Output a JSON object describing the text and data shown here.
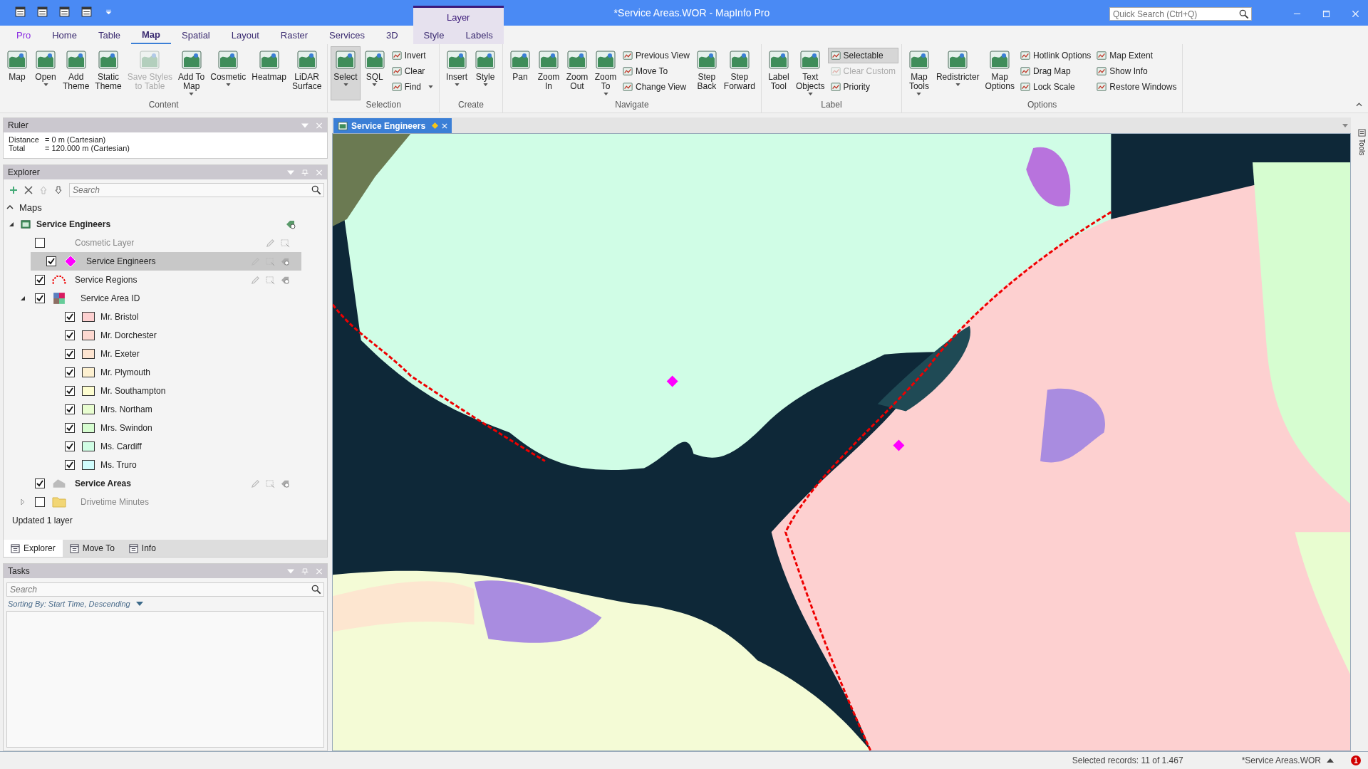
{
  "window": {
    "title": "*Service Areas.WOR - MapInfo Pro",
    "quick_search": {
      "placeholder": "Quick Search (Ctrl+Q)"
    }
  },
  "ribbon_tabs": [
    {
      "label": "Pro",
      "kind": "file",
      "selected": false
    },
    {
      "label": "Home",
      "kind": "normal",
      "selected": false
    },
    {
      "label": "Table",
      "kind": "normal",
      "selected": false
    },
    {
      "label": "Map",
      "kind": "normal",
      "selected": true
    },
    {
      "label": "Spatial",
      "kind": "normal",
      "selected": false
    },
    {
      "label": "Layout",
      "kind": "normal",
      "selected": false
    },
    {
      "label": "Raster",
      "kind": "normal",
      "selected": false
    },
    {
      "label": "Services",
      "kind": "normal",
      "selected": false
    },
    {
      "label": "3D",
      "kind": "normal",
      "selected": false
    },
    {
      "label": "Style",
      "kind": "contextual",
      "selected": false
    },
    {
      "label": "Labels",
      "kind": "contextual",
      "selected": false
    }
  ],
  "contextual_group": "Layer",
  "ribbon_groups": [
    {
      "label": "Content",
      "items": [
        {
          "kind": "large",
          "label": "Map",
          "dropdown": false,
          "disabled": false,
          "selected": false
        },
        {
          "kind": "large",
          "label": "Open",
          "dropdown": true,
          "disabled": false,
          "selected": false
        },
        {
          "kind": "large",
          "label": "Add\nTheme",
          "dropdown": false,
          "disabled": false,
          "selected": false
        },
        {
          "kind": "large",
          "label": "Static\nTheme",
          "dropdown": false,
          "disabled": false,
          "selected": false
        },
        {
          "kind": "large",
          "label": "Save Styles\nto Table",
          "dropdown": false,
          "disabled": true,
          "selected": false
        },
        {
          "kind": "large",
          "label": "Add To\nMap",
          "dropdown": true,
          "disabled": false,
          "selected": false
        },
        {
          "kind": "large",
          "label": "Cosmetic",
          "dropdown": true,
          "disabled": false,
          "selected": false
        },
        {
          "kind": "large",
          "label": "Heatmap",
          "dropdown": false,
          "disabled": false,
          "selected": false
        },
        {
          "kind": "large",
          "label": "LiDAR\nSurface",
          "dropdown": false,
          "disabled": false,
          "selected": false
        }
      ]
    },
    {
      "label": "Selection",
      "items": [
        {
          "kind": "large",
          "label": "Select",
          "dropdown": true,
          "disabled": false,
          "selected": true
        },
        {
          "kind": "large",
          "label": "SQL",
          "dropdown": true,
          "disabled": false,
          "selected": false
        },
        {
          "kind": "stack",
          "items": [
            {
              "label": "Invert",
              "dropdown": false,
              "disabled": false,
              "selected": false
            },
            {
              "label": "Clear",
              "dropdown": false,
              "disabled": false,
              "selected": false
            },
            {
              "label": "Find",
              "dropdown": true,
              "disabled": false,
              "selected": false
            }
          ]
        }
      ]
    },
    {
      "label": "Create",
      "items": [
        {
          "kind": "large",
          "label": "Insert",
          "dropdown": true,
          "disabled": false,
          "selected": false
        },
        {
          "kind": "large",
          "label": "Style",
          "dropdown": true,
          "disabled": false,
          "selected": false
        }
      ]
    },
    {
      "label": "Navigate",
      "items": [
        {
          "kind": "large",
          "label": "Pan",
          "dropdown": false,
          "disabled": false,
          "selected": false
        },
        {
          "kind": "large",
          "label": "Zoom\nIn",
          "dropdown": false,
          "disabled": false,
          "selected": false
        },
        {
          "kind": "large",
          "label": "Zoom\nOut",
          "dropdown": false,
          "disabled": false,
          "selected": false
        },
        {
          "kind": "large",
          "label": "Zoom\nTo",
          "dropdown": true,
          "disabled": false,
          "selected": false
        },
        {
          "kind": "stack",
          "items": [
            {
              "label": "Previous View",
              "dropdown": false,
              "disabled": false,
              "selected": false
            },
            {
              "label": "Move To",
              "dropdown": false,
              "disabled": false,
              "selected": false
            },
            {
              "label": "Change View",
              "dropdown": false,
              "disabled": false,
              "selected": false
            }
          ]
        },
        {
          "kind": "large",
          "label": "Step\nBack",
          "dropdown": false,
          "disabled": false,
          "selected": false
        },
        {
          "kind": "large",
          "label": "Step\nForward",
          "dropdown": false,
          "disabled": false,
          "selected": false
        }
      ]
    },
    {
      "label": "Label",
      "items": [
        {
          "kind": "large",
          "label": "Label\nTool",
          "dropdown": false,
          "disabled": false,
          "selected": false
        },
        {
          "kind": "large",
          "label": "Text\nObjects",
          "dropdown": true,
          "disabled": false,
          "selected": false
        },
        {
          "kind": "stack",
          "items": [
            {
              "label": "Selectable",
              "dropdown": false,
              "disabled": false,
              "selected": true
            },
            {
              "label": "Clear Custom",
              "dropdown": false,
              "disabled": true,
              "selected": false
            },
            {
              "label": "Priority",
              "dropdown": false,
              "disabled": false,
              "selected": false
            }
          ]
        }
      ]
    },
    {
      "label": "Options",
      "items": [
        {
          "kind": "large",
          "label": "Map\nTools",
          "dropdown": true,
          "disabled": false,
          "selected": false
        },
        {
          "kind": "large",
          "label": "Redistricter",
          "dropdown": true,
          "disabled": false,
          "selected": false
        },
        {
          "kind": "large",
          "label": "Map\nOptions",
          "dropdown": false,
          "disabled": false,
          "selected": false
        },
        {
          "kind": "stack",
          "items": [
            {
              "label": "Hotlink Options",
              "dropdown": false,
              "disabled": false,
              "selected": false
            },
            {
              "label": "Drag Map",
              "dropdown": false,
              "disabled": false,
              "selected": false
            },
            {
              "label": "Lock Scale",
              "dropdown": false,
              "disabled": false,
              "selected": false
            }
          ]
        },
        {
          "kind": "stack",
          "items": [
            {
              "label": "Map Extent",
              "dropdown": false,
              "disabled": false,
              "selected": false
            },
            {
              "label": "Show Info",
              "dropdown": false,
              "disabled": false,
              "selected": false
            },
            {
              "label": "Restore Windows",
              "dropdown": false,
              "disabled": false,
              "selected": false
            }
          ]
        }
      ]
    }
  ],
  "ruler": {
    "title": "Ruler",
    "rows": [
      {
        "label": "Distance",
        "value": "= 0 m (Cartesian)"
      },
      {
        "label": "Total",
        "value": "= 120.000 m (Cartesian)"
      }
    ]
  },
  "explorer": {
    "title": "Explorer",
    "search": {
      "placeholder": "Search"
    },
    "tree": [
      {
        "label": "Maps",
        "kind": "section",
        "expanded": true,
        "children": [
          {
            "label": "Service Engineers",
            "kind": "map",
            "expanded": true,
            "children": [
              {
                "label": "Cosmetic Layer",
                "kind": "cosmetic",
                "checked": false,
                "dimmed": true,
                "selected": false
              },
              {
                "label": "Service Engineers",
                "kind": "point",
                "checked": true,
                "dimmed": false,
                "selected": true
              },
              {
                "label": "Service Regions",
                "kind": "boundary",
                "checked": true,
                "dimmed": false,
                "selected": false
              },
              {
                "label": "Service Area ID",
                "kind": "theme",
                "checked": true,
                "dimmed": false,
                "selected": false,
                "expanded": true,
                "children": [
                  {
                    "label": "Mr. Bristol",
                    "kind": "swatch",
                    "checked": true,
                    "color": "#fdd0d0"
                  },
                  {
                    "label": "Mr. Dorchester",
                    "kind": "swatch",
                    "checked": true,
                    "color": "#fdd8d0"
                  },
                  {
                    "label": "Mr. Exeter",
                    "kind": "swatch",
                    "checked": true,
                    "color": "#fde4d0"
                  },
                  {
                    "label": "Mr. Plymouth",
                    "kind": "swatch",
                    "checked": true,
                    "color": "#fdf0d0"
                  },
                  {
                    "label": "Mr. Southampton",
                    "kind": "swatch",
                    "checked": true,
                    "color": "#fdfdd0"
                  },
                  {
                    "label": "Mrs. Northam",
                    "kind": "swatch",
                    "checked": true,
                    "color": "#e8fdd0"
                  },
                  {
                    "label": "Mrs. Swindon",
                    "kind": "swatch",
                    "checked": true,
                    "color": "#d6fdd0"
                  },
                  {
                    "label": "Ms. Cardiff",
                    "kind": "swatch",
                    "checked": true,
                    "color": "#d0fde4"
                  },
                  {
                    "label": "Ms. Truro",
                    "kind": "swatch",
                    "checked": true,
                    "color": "#d0fdfd"
                  }
                ]
              },
              {
                "label": "Service Areas",
                "kind": "region",
                "checked": true,
                "dimmed": false,
                "selected": false,
                "bold": true
              },
              {
                "label": "Drivetime Minutes",
                "kind": "folder",
                "checked": false,
                "dimmed": true,
                "selected": false,
                "expanded": false
              }
            ]
          }
        ]
      }
    ],
    "status": "Updated 1 layer"
  },
  "panel_tabs": [
    {
      "label": "Explorer",
      "selected": true
    },
    {
      "label": "Move To",
      "selected": false
    },
    {
      "label": "Info",
      "selected": false
    }
  ],
  "tasks": {
    "title": "Tasks",
    "search": {
      "placeholder": "Search"
    },
    "sorting": "Sorting By: Start Time, Descending"
  },
  "map_window": {
    "tab": {
      "label": "Service Engineers",
      "modified": true
    },
    "side_tab": "Tools"
  },
  "status_bar": {
    "selection": "Selected records: 11 of 1.467",
    "workspace": "*Service Areas.WOR",
    "notifications": "1"
  }
}
